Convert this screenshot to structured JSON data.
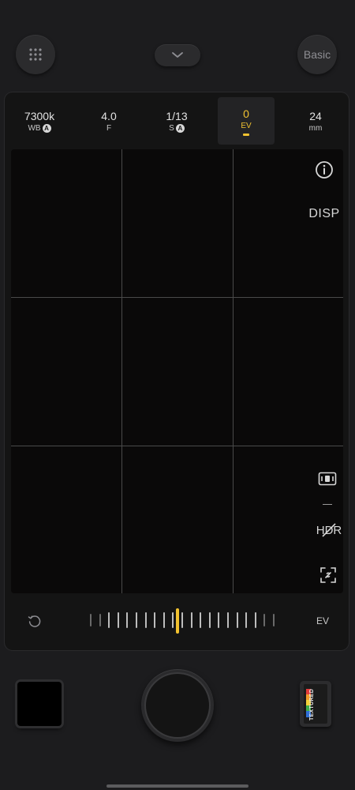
{
  "top_bar": {
    "basic_label": "Basic",
    "grid_icon": "grid-dots-icon",
    "chevron_icon": "chevron-down-icon"
  },
  "params": {
    "wb": {
      "value": "7300k",
      "label": "WB",
      "badge": "A"
    },
    "aperture": {
      "value": "4.0",
      "label": "F"
    },
    "shutter": {
      "value": "1/13",
      "label": "S",
      "badge": "A"
    },
    "ev": {
      "value": "0",
      "label": "EV"
    },
    "focal": {
      "value": "24",
      "label": "mm"
    }
  },
  "viewfinder": {
    "info_icon": "info-icon",
    "disp_label": "DISP",
    "metering_icon": "metering-icon",
    "hdr_label": "HDR",
    "focus_icon": "focus-frame-icon"
  },
  "slider": {
    "reset_icon": "reset-icon",
    "label": "EV",
    "value": 0
  },
  "bottom": {
    "film_label": "TEXTURED"
  },
  "colors": {
    "accent": "#f2c230",
    "background": "#1c1c1e",
    "panel": "#141414"
  }
}
